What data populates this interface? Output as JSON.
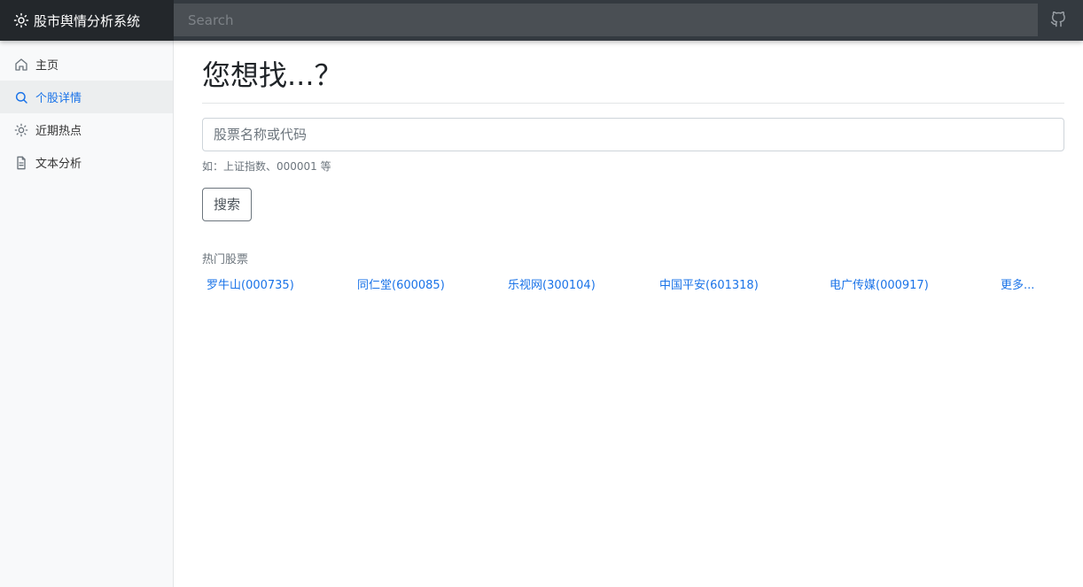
{
  "header": {
    "app_title": "股市舆情分析系统",
    "search_placeholder": "Search"
  },
  "sidebar": {
    "items": [
      {
        "label": "主页",
        "icon": "home-icon"
      },
      {
        "label": "个股详情",
        "icon": "search-icon",
        "active": true
      },
      {
        "label": "近期热点",
        "icon": "sun-icon"
      },
      {
        "label": "文本分析",
        "icon": "document-icon"
      }
    ]
  },
  "main": {
    "title": "您想找...？",
    "input_placeholder": "股票名称或代码",
    "hint": "如：上证指数、000001 等",
    "search_button": "搜索",
    "hot_label": "热门股票",
    "hot_stocks": [
      "罗牛山(000735)",
      "同仁堂(600085)",
      "乐视网(300104)",
      "中国平安(601318)",
      "电广传媒(000917)"
    ],
    "more_link": "更多..."
  },
  "colors": {
    "topbar": "#343a40",
    "brand_bg": "#23272b",
    "accent": "#1a73e8",
    "sidebar_bg": "#f8f9fa"
  }
}
